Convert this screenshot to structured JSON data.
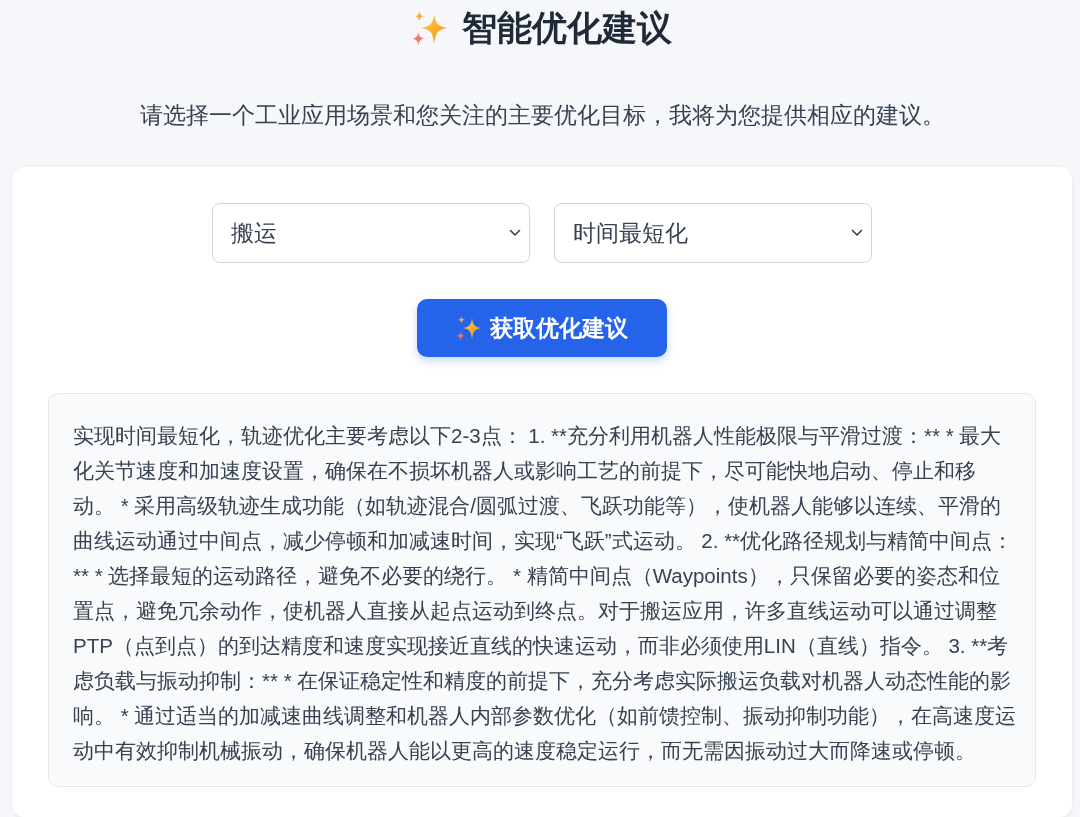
{
  "header": {
    "title": "智能优化建议",
    "subtitle": "请选择一个工业应用场景和您关注的主要优化目标，我将为您提供相应的建议。"
  },
  "form": {
    "selects": [
      {
        "value": "搬运"
      },
      {
        "value": "时间最短化"
      }
    ],
    "button": {
      "label": "获取优化建议"
    }
  },
  "result": {
    "text": "实现时间最短化，轨迹优化主要考虑以下2-3点： 1. **充分利用机器人性能极限与平滑过渡：** * 最大化关节速度和加速度设置，确保在不损坏机器人或影响工艺的前提下，尽可能快地启动、停止和移动。 * 采用高级轨迹生成功能（如轨迹混合/圆弧过渡、飞跃功能等），使机器人能够以连续、平滑的曲线运动通过中间点，减少停顿和加减速时间，实现“飞跃”式运动。 2. **优化路径规划与精简中间点：** * 选择最短的运动路径，避免不必要的绕行。 * 精简中间点（Waypoints），只保留必要的姿态和位置点，避免冗余动作，使机器人直接从起点运动到终点。对于搬运应用，许多直线运动可以通过调整PTP（点到点）的到达精度和速度实现接近直线的快速运动，而非必须使用LIN（直线）指令。 3. **考虑负载与振动抑制：** * 在保证稳定性和精度的前提下，充分考虑实际搬运负载对机器人动态性能的影响。 * 通过适当的加减速曲线调整和机器人内部参数优化（如前馈控制、振动抑制功能），在高速度运动中有效抑制机械振动，确保机器人能以更高的速度稳定运行，而无需因振动过大而降速或停顿。"
  }
}
